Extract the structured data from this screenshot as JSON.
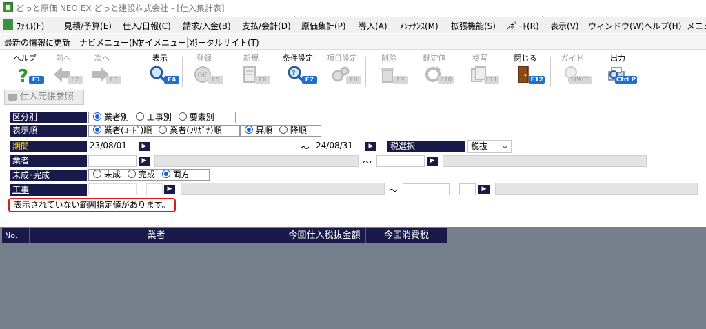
{
  "window": {
    "title": "どっと原価 NEO EX どっと建設株式会社 - [仕入集計表]"
  },
  "menu": [
    "ﾌｧｲﾙ(F)",
    "見積/予算(E)",
    "仕入/日報(C)",
    "請求/入金(B)",
    "支払/会計(D)",
    "原価集計(P)",
    "導入(A)",
    "ﾒﾝﾃﾅﾝｽ(M)",
    "拡張機能(S)",
    "ﾚﾎﾟｰﾄ(R)",
    "表示(V)",
    "ウィンドウ(W)",
    "ヘルプ(H)",
    "メニュ"
  ],
  "quickbar": [
    "最新の情報に更新",
    "ナビメニュー(N)",
    "マイメニュー(Y)",
    "ポータルサイト(T)"
  ],
  "toolbar": [
    {
      "label": "ヘルプ",
      "key": "F1",
      "icon": "help-icon",
      "enabled": true
    },
    {
      "label": "前へ",
      "key": "F2",
      "icon": "arrow-left-icon",
      "enabled": false
    },
    {
      "label": "次へ",
      "key": "F3",
      "icon": "arrow-right-icon",
      "enabled": false
    },
    {
      "label": "表示",
      "key": "F4",
      "icon": "magnifier-icon",
      "enabled": true
    },
    {
      "label": "登録",
      "key": "F5",
      "icon": "ok-icon",
      "enabled": false
    },
    {
      "label": "新規",
      "key": "F6",
      "icon": "new-document-icon",
      "enabled": false
    },
    {
      "label": "条件設定",
      "key": "F7",
      "icon": "condition-search-icon",
      "enabled": true
    },
    {
      "label": "項目設定",
      "key": "F8",
      "icon": "gears-icon",
      "enabled": false
    },
    {
      "label": "削除",
      "key": "F9",
      "icon": "trash-icon",
      "enabled": false
    },
    {
      "label": "既定値",
      "key": "F10",
      "icon": "refresh-icon",
      "enabled": false
    },
    {
      "label": "複写",
      "key": "F11",
      "icon": "copy-icon",
      "enabled": false
    },
    {
      "label": "閉じる",
      "key": "F12",
      "icon": "door-icon",
      "enabled": true
    },
    {
      "label": "ガイド",
      "key": "SPACE",
      "icon": "lightbulb-icon",
      "enabled": false
    },
    {
      "label": "出力",
      "key": "Ctrl P",
      "icon": "printer-icon",
      "enabled": true
    }
  ],
  "ref_button": "仕入元帳参照",
  "form": {
    "kubun": {
      "label": "区分別",
      "options": [
        "業者別",
        "工事別",
        "要素別"
      ],
      "selected": 0
    },
    "order": {
      "label": "表示順",
      "options": [
        "業者(ｺｰﾄﾞ)順",
        "業者(ﾌﾘｶﾞﾅ)順"
      ],
      "selected": 0,
      "dir_options": [
        "昇順",
        "降順"
      ],
      "dir_selected": 0
    },
    "period": {
      "label": "期間",
      "from": "23/08/01",
      "to": "24/08/31"
    },
    "tax": {
      "label": "税選択",
      "value": "税抜"
    },
    "vendor": {
      "label": "業者"
    },
    "status": {
      "label": "未成･完成",
      "options": [
        "未成",
        "完成",
        "両方"
      ],
      "selected": 2
    },
    "project": {
      "label": "工事"
    },
    "tilde": "～",
    "dash": "-",
    "pick": "▶"
  },
  "message": "表示されていない範囲指定値があります。",
  "grid": {
    "columns": [
      "No.",
      "業者",
      "今回仕入税抜金額",
      "今回消費税"
    ]
  },
  "colors": {
    "label_bg": "#1a1a4a",
    "accent": "#1e6fd0",
    "alert": "#e01818",
    "grid_bg": "#76808c"
  }
}
